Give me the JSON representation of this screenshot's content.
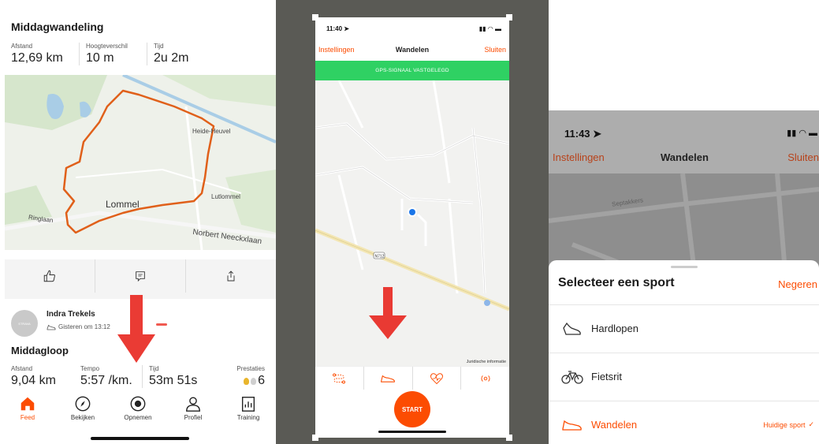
{
  "panel1": {
    "activity1": {
      "title": "Middagwandeling",
      "stats": [
        {
          "label": "Afstand",
          "value": "12,69 km"
        },
        {
          "label": "Hoogteverschil",
          "value": "10 m"
        },
        {
          "label": "Tijd",
          "value": "2u 2m"
        }
      ],
      "map_labels": {
        "heide": "Heide-Heuvel",
        "lommel": "Lommel",
        "lutlommel": "Lutlommel",
        "ringlaan": "Ringlaan",
        "norbert": "Norbert Neeckxlaan"
      }
    },
    "post": {
      "user": "Indra Trekels",
      "time": "Gisteren om 13:12",
      "avatar_text": "STRAVA"
    },
    "activity2": {
      "title": "Middagloop",
      "stats": [
        {
          "label": "Afstand",
          "value": "9,04 km"
        },
        {
          "label": "Tempo",
          "value": "5:57 /km."
        },
        {
          "label": "Tijd",
          "value": "53m 51s"
        },
        {
          "label": "Prestaties",
          "value": "6"
        }
      ]
    },
    "nav": [
      {
        "label": "Feed",
        "icon": "home-icon",
        "active": true
      },
      {
        "label": "Bekijken",
        "icon": "compass-icon",
        "active": false
      },
      {
        "label": "Opnemen",
        "icon": "record-icon",
        "active": false
      },
      {
        "label": "Profiel",
        "icon": "person-icon",
        "active": false
      },
      {
        "label": "Training",
        "icon": "chart-icon",
        "active": false
      }
    ]
  },
  "panel2": {
    "status_time": "11:40",
    "nav": {
      "left": "Instellingen",
      "title": "Wandelen",
      "right": "Sluiten"
    },
    "gps_banner": "GPS-SIGNAAL VASTGELEGD",
    "map_road_tag": "N712",
    "legal": "Juridische informatie",
    "start_label": "START"
  },
  "panel3": {
    "status_time": "11:43",
    "nav": {
      "left": "Instellingen",
      "title": "Wandelen",
      "right": "Sluiten"
    },
    "map_labels": {
      "street": "Septakkers"
    },
    "sheet": {
      "title": "Selecteer een sport",
      "ignore": "Negeren",
      "items": [
        {
          "label": "Hardlopen",
          "icon": "shoe-icon"
        },
        {
          "label": "Fietsrit",
          "icon": "bike-icon"
        },
        {
          "label": "Wandelen",
          "icon": "walking-shoe-icon",
          "current": true,
          "tag": "Huidige sport"
        }
      ]
    }
  },
  "colors": {
    "accent": "#fc4c02",
    "gps_green": "#2fd163",
    "arrow_red": "#e8261e",
    "route": "#e0601a"
  }
}
